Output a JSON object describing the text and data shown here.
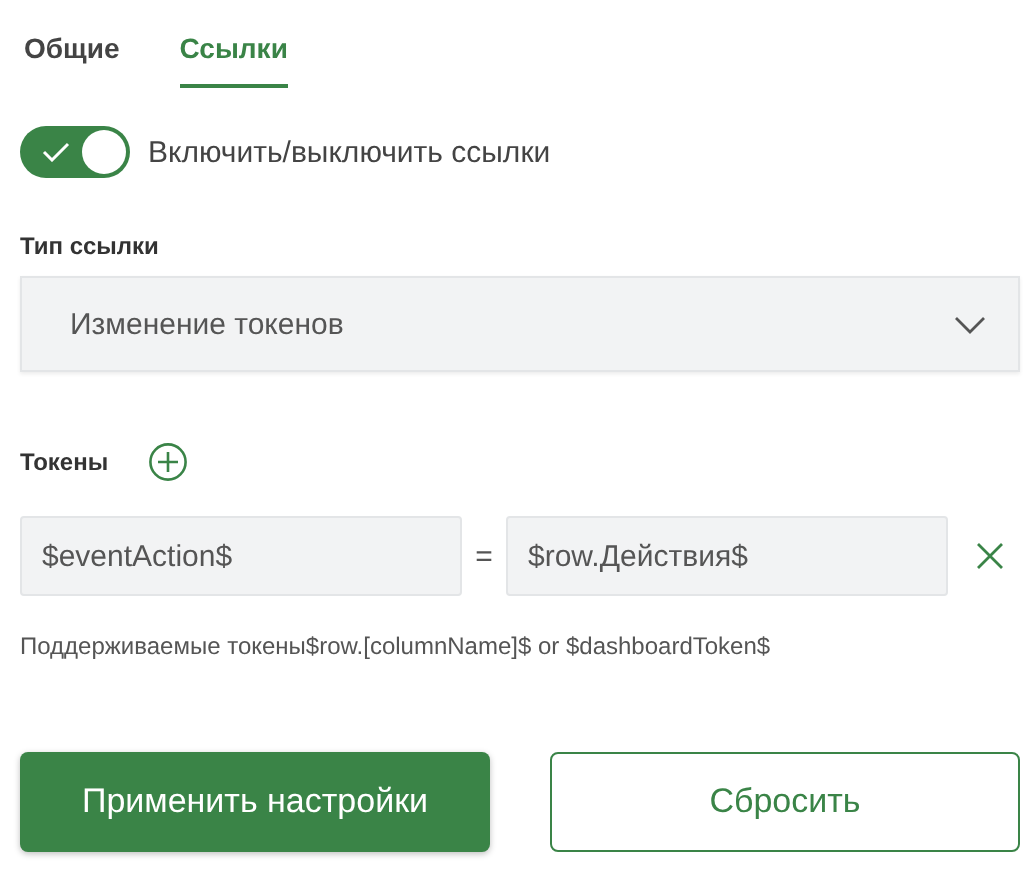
{
  "tabs": [
    {
      "label": "Общие",
      "selected": false
    },
    {
      "label": "Ссылки",
      "selected": true
    }
  ],
  "toggle": {
    "label": "Включить/выключить ссылки",
    "on": true
  },
  "link_type": {
    "label": "Тип ссылки",
    "value": "Изменение токенов"
  },
  "tokens": {
    "label": "Токены",
    "rows": [
      {
        "key": "$eventAction$",
        "operator": "=",
        "value": "$row.Действия$"
      }
    ]
  },
  "hint": "Поддерживаемые токены$row.[columnName]$ or $dashboardToken$",
  "buttons": [
    {
      "label": "Применить настройки",
      "kind": "primary"
    },
    {
      "label": "Сбросить",
      "kind": "secondary"
    }
  ]
}
